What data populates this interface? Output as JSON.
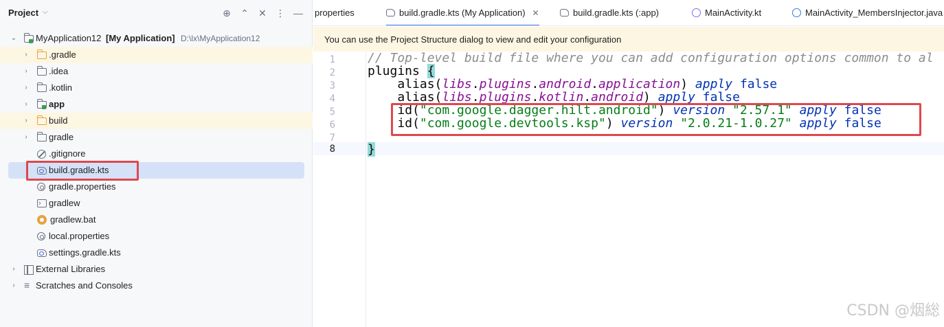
{
  "project_panel": {
    "title": "Project",
    "tree": [
      {
        "label": "MyApplication12",
        "extra": "[My Application]",
        "path": "D:\\lx\\MyApplication12",
        "icon": "module-folder-icon"
      },
      {
        "label": ".gradle",
        "icon": "folder-icon"
      },
      {
        "label": ".idea",
        "icon": "folder-icon"
      },
      {
        "label": ".kotlin",
        "icon": "folder-icon"
      },
      {
        "label": "app",
        "icon": "module-folder-icon"
      },
      {
        "label": "build",
        "icon": "folder-icon"
      },
      {
        "label": "gradle",
        "icon": "folder-icon"
      },
      {
        "label": ".gitignore",
        "icon": "ignore-file-icon"
      },
      {
        "label": "build.gradle.kts",
        "icon": "gradle-kts-icon"
      },
      {
        "label": "gradle.properties",
        "icon": "settings-file-icon"
      },
      {
        "label": "gradlew",
        "icon": "terminal-file-icon"
      },
      {
        "label": "gradlew.bat",
        "icon": "bat-file-icon"
      },
      {
        "label": "local.properties",
        "icon": "settings-file-icon"
      },
      {
        "label": "settings.gradle.kts",
        "icon": "gradle-kts-icon"
      },
      {
        "label": "External Libraries",
        "icon": "library-icon"
      },
      {
        "label": "Scratches and Consoles",
        "icon": "scratches-icon"
      }
    ]
  },
  "tabs": [
    {
      "label": "properties"
    },
    {
      "label": "build.gradle.kts (My Application)"
    },
    {
      "label": "build.gradle.kts (:app)"
    },
    {
      "label": "MainActivity.kt"
    },
    {
      "label": "MainActivity_MembersInjector.java"
    }
  ],
  "banner": "You can use the Project Structure dialog to view and edit your configuration",
  "editor": {
    "line_numbers": [
      "1",
      "2",
      "3",
      "4",
      "5",
      "6",
      "7",
      "8"
    ],
    "code": {
      "l1": "// Top-level build file where you can add configuration options common to al",
      "l2_plugins": "plugins ",
      "l2_brace": "{",
      "l3_alias": "alias(",
      "l3_libs": "libs",
      "l3_dot1": ".",
      "l3_plugins": "plugins",
      "l3_dot2": ".",
      "l3_android": "android",
      "l3_dot3": ".",
      "l3_application": "application",
      "l3_close": ") ",
      "l3_apply": "apply",
      "l3_false": "false",
      "l4_alias": "alias(",
      "l4_libs": "libs",
      "l4_dot1": ".",
      "l4_plugins": "plugins",
      "l4_dot2": ".",
      "l4_kotlin": "kotlin",
      "l4_dot3": ".",
      "l4_android": "android",
      "l4_close": ") ",
      "l4_apply": "apply",
      "l4_false": "false",
      "l5_id": "id(",
      "l5_str": "\"com.google.dagger.hilt.android\"",
      "l5_close": ") ",
      "l5_version": "version",
      "l5_ver": "\"2.57.1\"",
      "l5_apply": "apply",
      "l5_false": "false",
      "l6_id": "id(",
      "l6_str": "\"com.google.devtools.ksp\"",
      "l6_close": ") ",
      "l6_version": "version",
      "l6_ver": "\"2.0.21-1.0.27\"",
      "l6_apply": "apply",
      "l6_false": "false",
      "l8_brace": "}"
    }
  },
  "watermark": "CSDN @烟総",
  "colors": {
    "highlight_box": "#e0474c",
    "accent": "#3574f0"
  }
}
